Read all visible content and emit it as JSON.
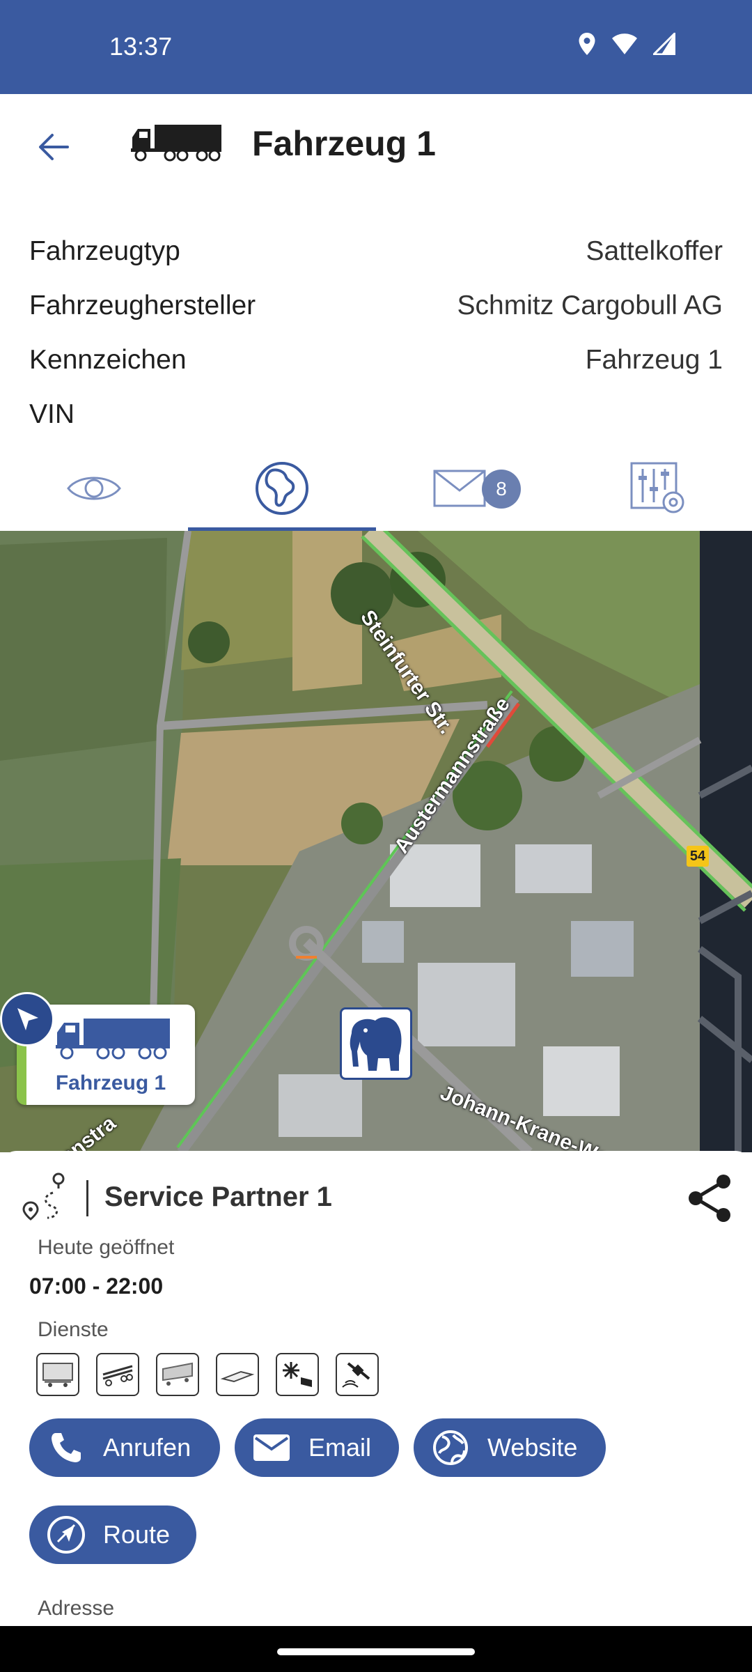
{
  "status_bar": {
    "time": "13:37",
    "icons": [
      "location-icon",
      "wifi-icon",
      "signal-icon"
    ]
  },
  "header": {
    "title": "Fahrzeug 1",
    "back_icon": "arrow-left-icon",
    "vehicle_icon": "truck-icon"
  },
  "vehicle_info": [
    {
      "label": "Fahrzeugtyp",
      "value": "Sattelkoffer"
    },
    {
      "label": "Fahrzeughersteller",
      "value": "Schmitz Cargobull AG"
    },
    {
      "label": "Kennzeichen",
      "value": "Fahrzeug 1"
    },
    {
      "label": "VIN",
      "value": ""
    }
  ],
  "tabs": [
    {
      "icon": "eye-icon",
      "selected": false
    },
    {
      "icon": "globe-icon",
      "selected": true
    },
    {
      "icon": "mail-icon",
      "selected": false,
      "badge": "8"
    },
    {
      "icon": "settings-sliders-icon",
      "selected": false
    }
  ],
  "map": {
    "streets": [
      "Steinfurter Str.",
      "Austermannstraße",
      "Johann-Krane-Weg",
      "nnstra"
    ],
    "road_number": "54",
    "vehicle_marker_label": "Fahrzeug 1",
    "partner_marker_icon": "elephant-icon"
  },
  "partner": {
    "name": "Service Partner 1",
    "open_label": "Heute geöffnet",
    "hours": "07:00 - 22:00",
    "services_label": "Dienste",
    "services": [
      "box-trailer-icon",
      "chassis-icon",
      "curtain-trailer-icon",
      "flatbed-icon",
      "refrigeration-icon",
      "telematics-icon"
    ],
    "address_label": "Adresse"
  },
  "actions": {
    "call": "Anrufen",
    "email": "Email",
    "website": "Website",
    "route": "Route"
  },
  "colors": {
    "primary": "#3a5aa0",
    "badge": "#6a7fb0",
    "vehicle_status": "#8bc34a"
  }
}
